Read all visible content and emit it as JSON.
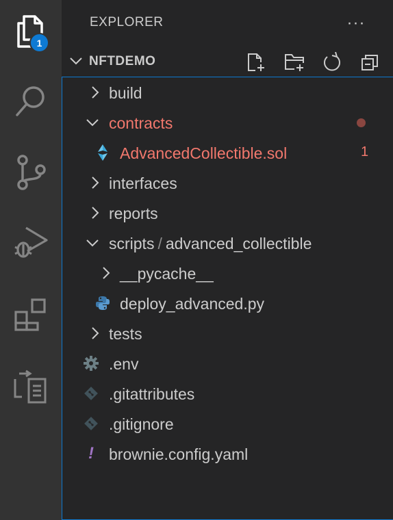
{
  "activity_bar": {
    "explorer_badge": "1",
    "icons": [
      "files-icon",
      "search-icon",
      "source-control-icon",
      "run-debug-icon",
      "extensions-icon",
      "remote-explorer-icon"
    ]
  },
  "sidebar": {
    "title": "EXPLORER",
    "more_glyph": "···",
    "folder_name": "NFTDEMO",
    "header_actions": [
      "new-file-icon",
      "new-folder-icon",
      "refresh-icon",
      "collapse-all-icon"
    ]
  },
  "tree": {
    "build": "build",
    "contracts": "contracts",
    "advanced_collectible": "AdvancedCollectible.sol",
    "advanced_collectible_problems": "1",
    "interfaces": "interfaces",
    "reports": "reports",
    "scripts": "scripts",
    "scripts_sep": "/",
    "scripts_sub": "advanced_collectible",
    "pycache": "__pycache__",
    "deploy": "deploy_advanced.py",
    "tests": "tests",
    "env": ".env",
    "gitattributes": ".gitattributes",
    "gitignore": ".gitignore",
    "brownie": "brownie.config.yaml",
    "yaml_glyph": "!"
  },
  "colors": {
    "error_text": "#f2786d",
    "focus_border": "#0d79d1",
    "badge": "#0e7ad3"
  }
}
